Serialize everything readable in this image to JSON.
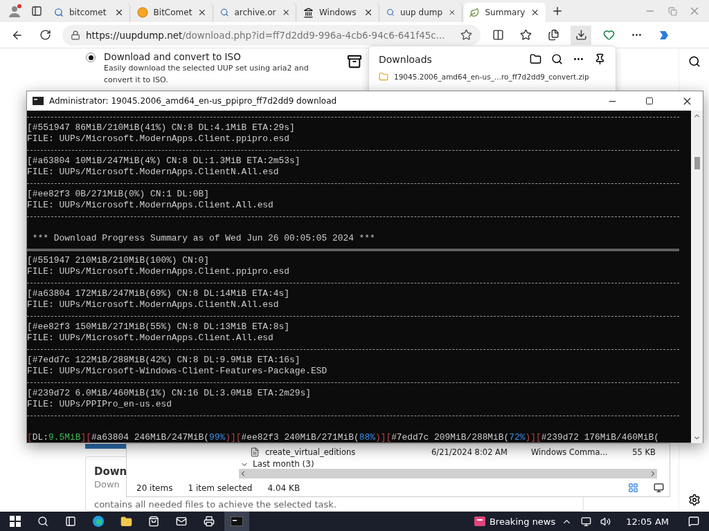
{
  "browser": {
    "tabs": [
      {
        "label": "bitcomet",
        "kind": "search",
        "selected": false
      },
      {
        "label": "BitComet",
        "kind": "orb",
        "selected": false
      },
      {
        "label": "archive.or",
        "kind": "search",
        "selected": false
      },
      {
        "label": "Windows",
        "kind": "museum",
        "selected": false
      },
      {
        "label": "uup dump",
        "kind": "search",
        "selected": false
      },
      {
        "label": "Summary",
        "kind": "leaf",
        "selected": true
      }
    ],
    "address": {
      "host": "https://uupdump.net",
      "path": "/download.php?id=ff7d2dd9-996a-4cb6-94c6-641f45c..."
    }
  },
  "page": {
    "option": {
      "label": "Download and convert to ISO",
      "description": "Easily download the selected UUP set using aria2 and convert it to ISO.",
      "selected": true
    },
    "card": {
      "title": "Down",
      "subtitle": "Down",
      "text": "contains all needed files to achieve the selected task."
    }
  },
  "downloads": {
    "title": "Downloads",
    "items": [
      "19045.2006_amd64_en-us_...ro_ff7d2dd9_convert.zip"
    ]
  },
  "console": {
    "title": "Administrator:  19045.2006_amd64_en-us_ppipro_ff7d2dd9 download",
    "lines": [
      {
        "kind": "rule"
      },
      {
        "kind": "text",
        "text": "[#551947 86MiB/210MiB(41%) CN:8 DL:4.1MiB ETA:29s]"
      },
      {
        "kind": "text",
        "text": "FILE: UUPs/Microsoft.ModernApps.Client.ppipro.esd"
      },
      {
        "kind": "rule"
      },
      {
        "kind": "text",
        "text": "[#a63804 10MiB/247MiB(4%) CN:8 DL:1.3MiB ETA:2m53s]"
      },
      {
        "kind": "text",
        "text": "FILE: UUPs/Microsoft.ModernApps.ClientN.All.esd"
      },
      {
        "kind": "rule"
      },
      {
        "kind": "text",
        "text": "[#ee82f3 0B/271MiB(0%) CN:1 DL:0B]"
      },
      {
        "kind": "text",
        "text": "FILE: UUPs/Microsoft.ModernApps.Client.All.esd"
      },
      {
        "kind": "rule"
      },
      {
        "kind": "blank"
      },
      {
        "kind": "text",
        "text": " *** Download Progress Summary as of Wed Jun 26 00:05:05 2024 ***"
      },
      {
        "kind": "double"
      },
      {
        "kind": "text",
        "text": "[#551947 210MiB/210MiB(100%) CN:0]"
      },
      {
        "kind": "text",
        "text": "FILE: UUPs/Microsoft.ModernApps.Client.ppipro.esd"
      },
      {
        "kind": "rule"
      },
      {
        "kind": "text",
        "text": "[#a63804 172MiB/247MiB(69%) CN:8 DL:14MiB ETA:4s]"
      },
      {
        "kind": "text",
        "text": "FILE: UUPs/Microsoft.ModernApps.ClientN.All.esd"
      },
      {
        "kind": "rule"
      },
      {
        "kind": "text",
        "text": "[#ee82f3 150MiB/271MiB(55%) CN:8 DL:13MiB ETA:8s]"
      },
      {
        "kind": "text",
        "text": "FILE: UUPs/Microsoft.ModernApps.Client.All.esd"
      },
      {
        "kind": "rule"
      },
      {
        "kind": "text",
        "text": "[#7edd7c 122MiB/288MiB(42%) CN:8 DL:9.9MiB ETA:16s]"
      },
      {
        "kind": "text",
        "text": "FILE: UUPs/Microsoft-Windows-Client-Features-Package.ESD"
      },
      {
        "kind": "rule"
      },
      {
        "kind": "text",
        "text": "[#239d72 6.0MiB/460MiB(1%) CN:16 DL:3.0MiB ETA:2m29s]"
      },
      {
        "kind": "text",
        "text": "FILE: UUPs/PPIPro_en-us.esd"
      },
      {
        "kind": "rule"
      },
      {
        "kind": "blank"
      }
    ],
    "status": [
      {
        "text": "[",
        "kind": "bracket"
      },
      {
        "text": "DL:",
        "kind": "plain"
      },
      {
        "text": "9.5MiB",
        "kind": "speed"
      },
      {
        "text": "][",
        "kind": "bracket"
      },
      {
        "text": "#a63804 246MiB/247MiB(",
        "kind": "plain"
      },
      {
        "text": "99%",
        "kind": "percent"
      },
      {
        "text": ")][",
        "kind": "bracket"
      },
      {
        "text": "#ee82f3 240MiB/271MiB(",
        "kind": "plain"
      },
      {
        "text": "88%",
        "kind": "percent"
      },
      {
        "text": ")][",
        "kind": "bracket"
      },
      {
        "text": "#7edd7c 209MiB/288MiB(",
        "kind": "plain"
      },
      {
        "text": "72%",
        "kind": "percent"
      },
      {
        "text": ")][",
        "kind": "bracket"
      },
      {
        "text": "#239d72 176MiB/460MiB(",
        "kind": "plain"
      }
    ]
  },
  "explorer": {
    "file": {
      "name": "create_virtual_editions",
      "date": "6/21/2024 8:02 AM",
      "type": "Windows Comma...",
      "size": "55 KB"
    },
    "group": "Last month (3)",
    "status": [
      "20 items",
      "1 item selected",
      "4.04 KB"
    ]
  },
  "taskbar": {
    "news": "Breaking news",
    "time": "12:05 AM"
  }
}
